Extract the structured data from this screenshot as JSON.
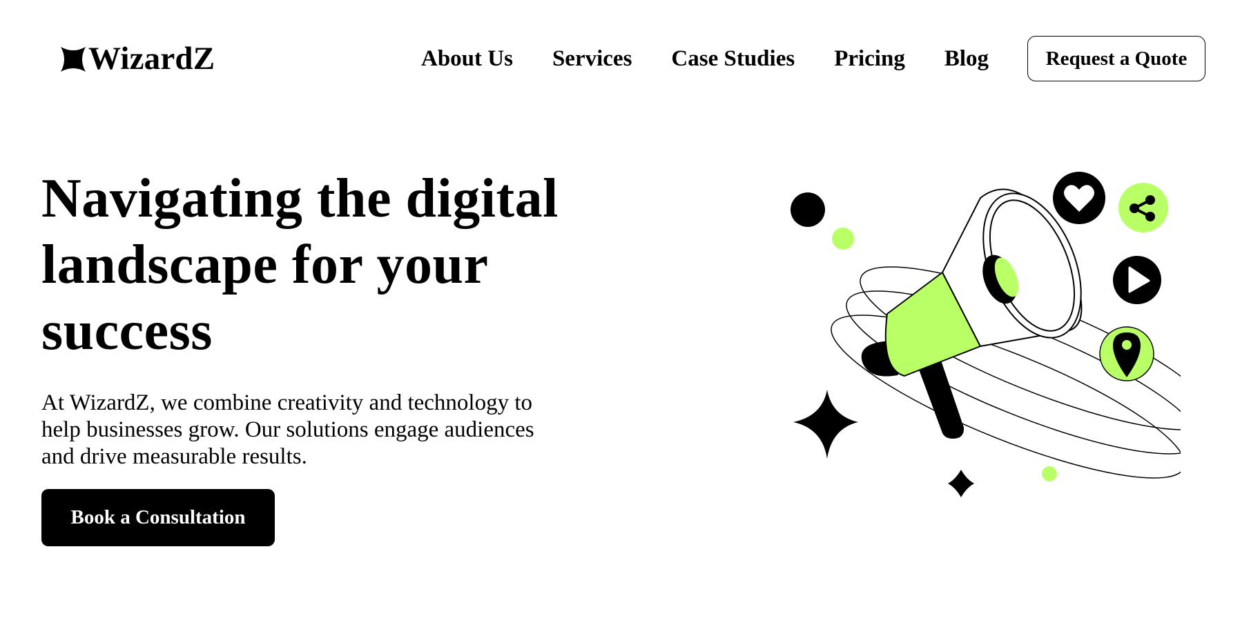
{
  "brand": {
    "name": "WizardZ",
    "logo_icon": "four-point-star-icon"
  },
  "nav": {
    "items": [
      {
        "label": "About Us"
      },
      {
        "label": "Services"
      },
      {
        "label": "Case Studies"
      },
      {
        "label": "Pricing"
      },
      {
        "label": "Blog"
      }
    ],
    "cta_label": "Request a Quote"
  },
  "hero": {
    "title": "Navigating the digital landscape for your success",
    "description": "At WizardZ, we combine creativity and technology to help businesses grow. Our solutions engage audiences and drive measurable results.",
    "cta_label": "Book a Consultation"
  },
  "illustration": {
    "icons": [
      "megaphone-icon",
      "heart-icon",
      "share-icon",
      "play-icon",
      "location-pin-icon",
      "sparkle-icon"
    ]
  },
  "colors": {
    "accent": "#b9ff66",
    "dark": "#000000",
    "background": "#ffffff"
  }
}
